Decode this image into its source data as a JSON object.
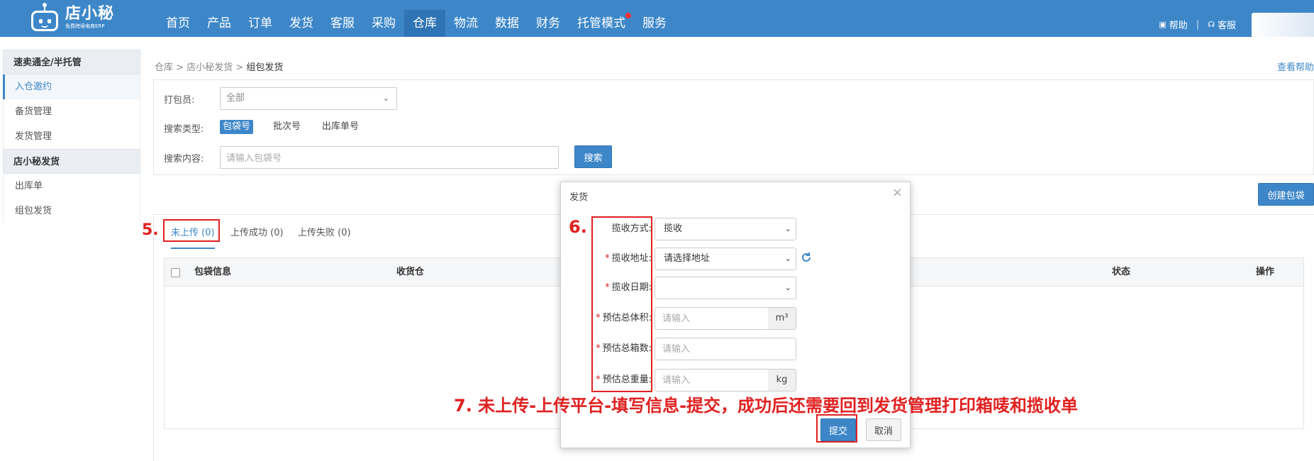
{
  "logo": {
    "name": "店小秘",
    "subtitle": "免费跨境电商ERP"
  },
  "nav": [
    {
      "label": "首页"
    },
    {
      "label": "产品"
    },
    {
      "label": "订单"
    },
    {
      "label": "发货"
    },
    {
      "label": "客服"
    },
    {
      "label": "采购"
    },
    {
      "label": "仓库"
    },
    {
      "label": "物流"
    },
    {
      "label": "数据"
    },
    {
      "label": "财务"
    },
    {
      "label": "托管模式"
    },
    {
      "label": "服务"
    }
  ],
  "nav_active": "仓库",
  "header_right": {
    "help": "帮助",
    "service": "客服"
  },
  "sidebar": {
    "groups": [
      {
        "title": "速卖通全/半托管",
        "items": [
          "入仓邀约",
          "备货管理",
          "发货管理"
        ]
      },
      {
        "title": "店小秘发货",
        "items": [
          "出库单",
          "组包发货"
        ]
      }
    ],
    "active_item": "入仓邀约"
  },
  "breadcrumb": {
    "p1": "仓库",
    "p2": "店小秘发货",
    "current": "组包发货",
    "sep": ">"
  },
  "help_link": "查看帮助",
  "filters": {
    "packer_label": "打包员:",
    "packer_value": "全部",
    "search_type_label": "搜索类型:",
    "search_types": [
      "包袋号",
      "批次号",
      "出库单号"
    ],
    "search_content_label": "搜索内容:",
    "search_placeholder": "请输入包袋号",
    "search_button": "搜索"
  },
  "create_button": "创建包袋",
  "tabs": [
    "未上传 (0)",
    "上传成功 (0)",
    "上传失败 (0)"
  ],
  "table_headers": [
    "包袋信息",
    "收货仓",
    "状态",
    "操作"
  ],
  "modal": {
    "title": "发货",
    "close": "×",
    "fields": {
      "pickup_method": {
        "label": "揽收方式:",
        "value": "揽收"
      },
      "pickup_address": {
        "label": "揽收地址:",
        "value": "请选择地址"
      },
      "pickup_date": {
        "label": "揽收日期:",
        "value": ""
      },
      "volume": {
        "label": "预估总体积:",
        "placeholder": "请输入",
        "unit": "m³"
      },
      "boxes": {
        "label": "预估总箱数:",
        "placeholder": "请输入"
      },
      "weight": {
        "label": "预估总重量:",
        "placeholder": "请输入",
        "unit": "kg"
      }
    },
    "required_mark": "*",
    "submit": "提交",
    "cancel": "取消"
  },
  "annotations": {
    "step5": "5.",
    "step6": "6.",
    "step7": "7. 未上传-上传平台-填写信息-提交，成功后还需要回到发货管理打印箱唛和揽收单"
  },
  "colors": {
    "primary": "#3d87c9",
    "nav_active": "#2f74b4",
    "annotation": "#e02020"
  }
}
